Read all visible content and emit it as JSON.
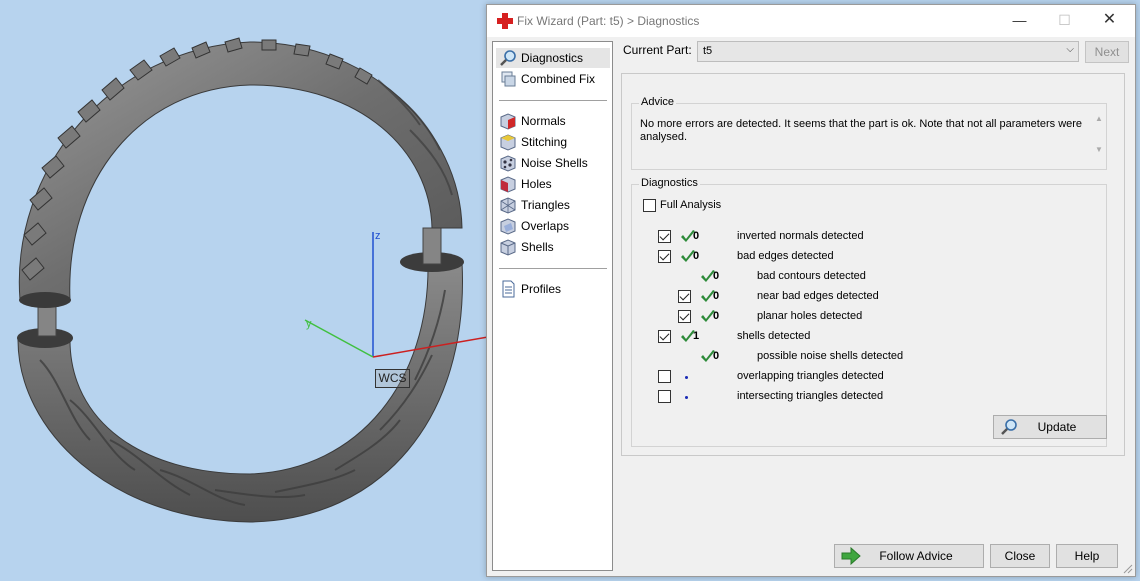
{
  "viewport": {
    "axis_z": "z",
    "axis_y": "y",
    "wcs_label": "WCS"
  },
  "dialog": {
    "title": "Fix Wizard (Part: t5) > Diagnostics",
    "minimize": "—",
    "maximize": "☐",
    "close": "✕"
  },
  "nav": {
    "group1": [
      {
        "label": "Diagnostics",
        "icon": "magnifier-icon",
        "selected": true
      },
      {
        "label": "Combined Fix",
        "icon": "stacked-cubes-icon"
      }
    ],
    "group2": [
      {
        "label": "Normals",
        "icon": "normals-cube-icon"
      },
      {
        "label": "Stitching",
        "icon": "stitching-cube-icon"
      },
      {
        "label": "Noise Shells",
        "icon": "noise-shells-icon"
      },
      {
        "label": "Holes",
        "icon": "holes-cube-icon"
      },
      {
        "label": "Triangles",
        "icon": "triangles-cube-icon"
      },
      {
        "label": "Overlaps",
        "icon": "overlaps-cube-icon"
      },
      {
        "label": "Shells",
        "icon": "shells-cube-icon"
      }
    ],
    "group3": [
      {
        "label": "Profiles",
        "icon": "document-icon"
      }
    ]
  },
  "part": {
    "label": "Current Part:",
    "value": "t5",
    "next_label": "Next"
  },
  "advice": {
    "title": "Advice",
    "text": "No more errors are detected. It seems that the part is ok. Note that not all parameters were analysed."
  },
  "diagnostics": {
    "title": "Diagnostics",
    "full_analysis_label": "Full Analysis",
    "full_analysis_checked": false,
    "rows": [
      {
        "checkbox": true,
        "checked": true,
        "status": "ok",
        "count": "0",
        "label": "inverted normals detected",
        "indent": 0
      },
      {
        "checkbox": true,
        "checked": true,
        "status": "ok",
        "count": "0",
        "label": "bad edges detected",
        "indent": 0
      },
      {
        "checkbox": false,
        "checked": false,
        "status": "ok",
        "count": "0",
        "label": "bad contours detected",
        "indent": 1
      },
      {
        "checkbox": true,
        "checked": true,
        "status": "ok",
        "count": "0",
        "label": "near bad edges detected",
        "indent": 1
      },
      {
        "checkbox": true,
        "checked": true,
        "status": "ok",
        "count": "0",
        "label": "planar holes detected",
        "indent": 1
      },
      {
        "checkbox": true,
        "checked": true,
        "status": "ok",
        "count": "1",
        "label": "shells detected",
        "indent": 0
      },
      {
        "checkbox": false,
        "checked": false,
        "status": "ok",
        "count": "0",
        "label": "possible noise shells detected",
        "indent": 1
      },
      {
        "checkbox": true,
        "checked": false,
        "status": "pending",
        "count": "",
        "label": "overlapping triangles detected",
        "indent": 0
      },
      {
        "checkbox": true,
        "checked": false,
        "status": "pending",
        "count": "",
        "label": "intersecting triangles detected",
        "indent": 0
      }
    ],
    "update_label": "Update"
  },
  "footer": {
    "follow_advice_label": "Follow Advice",
    "close_label": "Close",
    "help_label": "Help"
  },
  "colors": {
    "viewport_bg": "#b7d3ee",
    "ok_check": "#2e8b3a",
    "pending_dot": "#1a2bb5",
    "axis_x": "#cc2020",
    "axis_y": "#40c040",
    "axis_z": "#2050d0"
  }
}
